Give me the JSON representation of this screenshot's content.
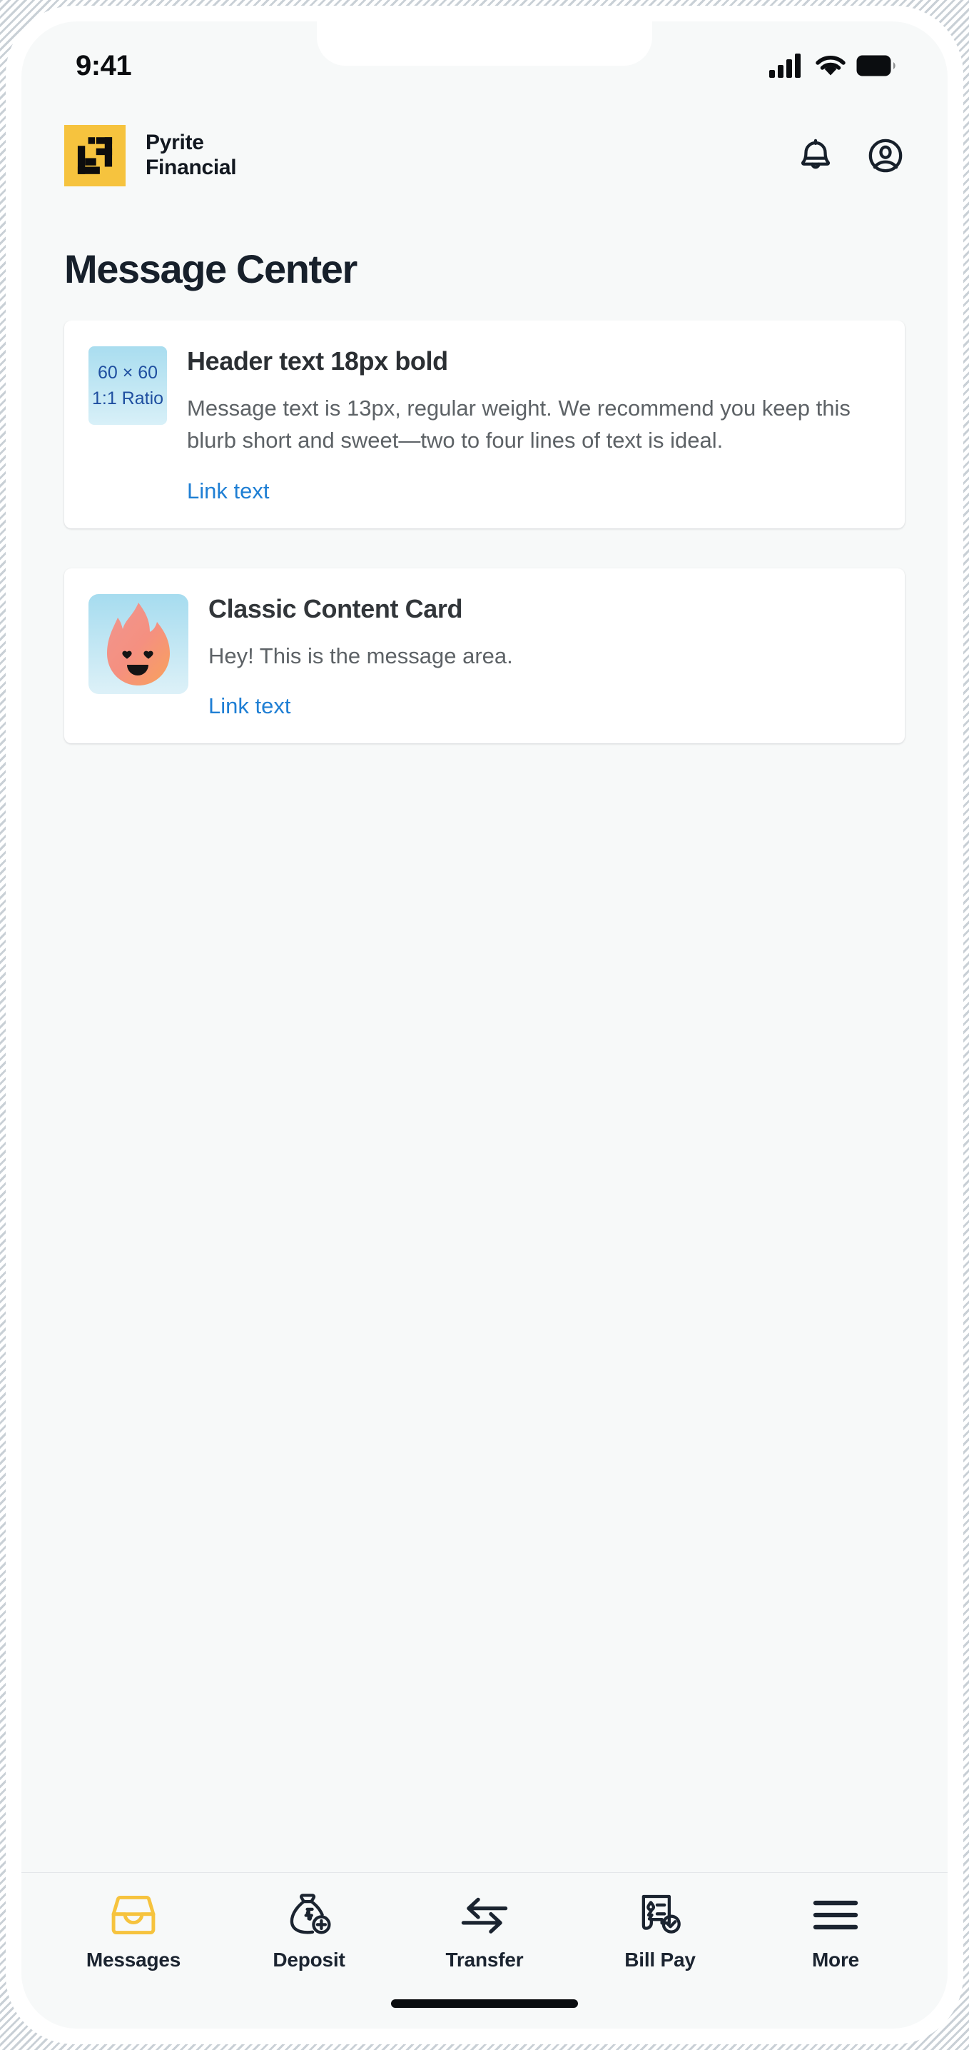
{
  "status_bar": {
    "time": "9:41",
    "icons": [
      "cellular-signal-icon",
      "wifi-icon",
      "battery-icon"
    ]
  },
  "header": {
    "brand_name": "Pyrite\nFinancial",
    "logo_icon": "pyrite-logo-icon",
    "logo_color": "#F6C33E",
    "actions": [
      {
        "name": "notifications-button",
        "icon": "bell-icon"
      },
      {
        "name": "account-button",
        "icon": "user-circle-icon"
      }
    ]
  },
  "page": {
    "title": "Message Center"
  },
  "cards": [
    {
      "thumb_type": "placeholder",
      "thumb_line1": "60 × 60",
      "thumb_line2": "1:1 Ratio",
      "title": "Header text 18px bold",
      "text": "Message text is 13px, regular weight. We recommend you keep this blurb short and sweet—two to four lines of text is ideal.",
      "link": "Link text"
    },
    {
      "thumb_type": "emoji",
      "thumb_icon": "flame-mascot-icon",
      "title": "Classic Content Card",
      "text": "Hey! This is the message area.",
      "link": "Link text"
    }
  ],
  "tab_bar": {
    "active_index": 0,
    "active_color": "#F6C33E",
    "inactive_color": "#1B2430",
    "tabs": [
      {
        "label": "Messages",
        "icon": "inbox-tray-icon"
      },
      {
        "label": "Deposit",
        "icon": "money-bag-plus-icon"
      },
      {
        "label": "Transfer",
        "icon": "transfer-arrows-icon"
      },
      {
        "label": "Bill Pay",
        "icon": "bill-check-icon"
      },
      {
        "label": "More",
        "icon": "hamburger-menu-icon"
      }
    ]
  }
}
